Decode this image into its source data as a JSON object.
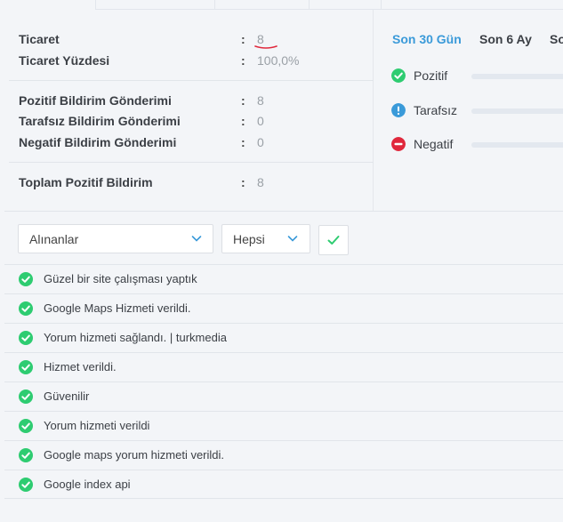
{
  "stats": {
    "colon": ":",
    "rows": [
      {
        "label": "Ticaret",
        "value": "8"
      },
      {
        "label": "Ticaret Yüzdesi",
        "value": "100,0%"
      },
      {
        "label": "Pozitif Bildirim Gönderimi",
        "value": "8"
      },
      {
        "label": "Tarafsız Bildirim Gönderimi",
        "value": "0"
      },
      {
        "label": "Negatif Bildirim Gönderimi",
        "value": "0"
      },
      {
        "label": "Toplam Pozitif Bildirim",
        "value": "8"
      }
    ]
  },
  "periods": {
    "tabs": [
      "Son 30 Gün",
      "Son 6 Ay",
      "So"
    ],
    "active_index": 0
  },
  "sentiments": [
    {
      "label": "Pozitif",
      "icon": "check-circle-icon",
      "color": "#2ecc71"
    },
    {
      "label": "Tarafsız",
      "icon": "info-circle-icon",
      "color": "#3a9ad9"
    },
    {
      "label": "Negatif",
      "icon": "minus-circle-icon",
      "color": "#e0283c"
    }
  ],
  "filters": {
    "direction_select": {
      "value": "Alınanlar"
    },
    "type_select": {
      "value": "Hepsi"
    },
    "confirm_icon": "check-icon"
  },
  "comments": [
    "Güzel bir site çalışması yaptık",
    "Google Maps Hizmeti verildi.",
    "Yorum hizmeti sağlandı. | turkmedia",
    "Hizmet verildi.",
    "Güvenilir",
    "Yorum hizmeti verildi",
    "Google maps yorum hizmeti verildi.",
    "Google index api"
  ],
  "colors": {
    "accent": "#3a9ad9",
    "positive": "#2ecc71",
    "neutral": "#3a9ad9",
    "negative": "#e0283c",
    "annotation": "#e0283c"
  }
}
